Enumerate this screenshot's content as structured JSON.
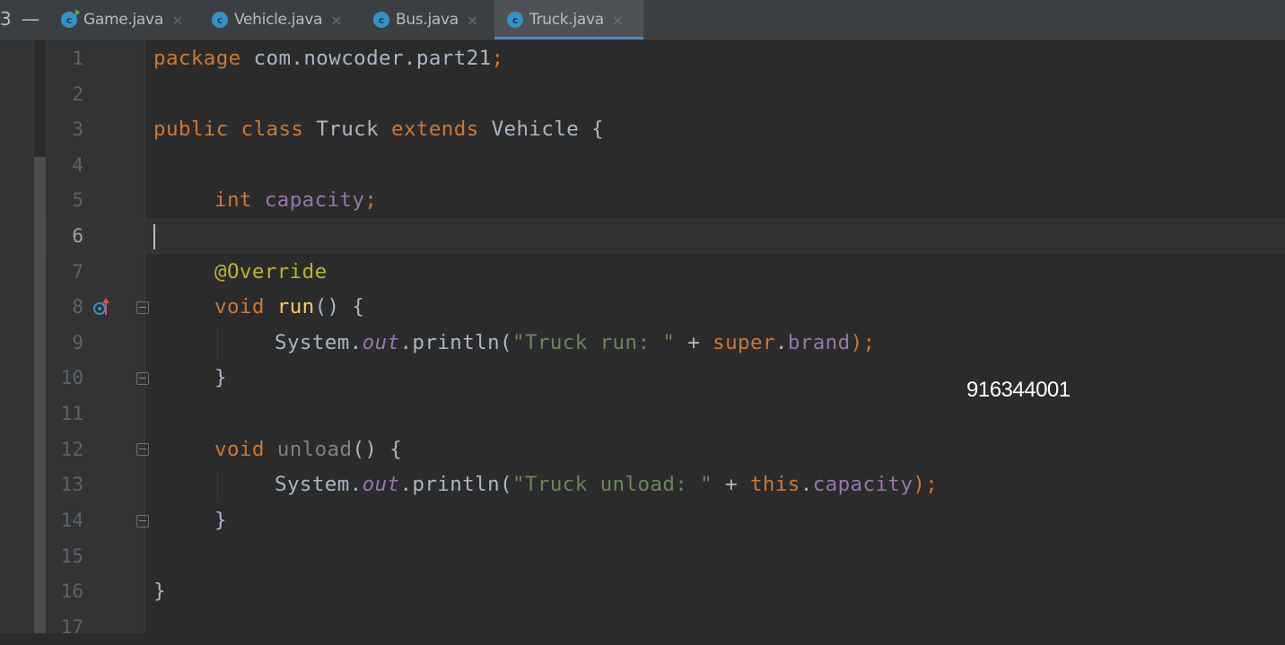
{
  "tabs": [
    {
      "label": "Game.java",
      "icon": "class-run-icon",
      "active": false
    },
    {
      "label": "Vehicle.java",
      "icon": "class-icon",
      "active": false
    },
    {
      "label": "Bus.java",
      "icon": "class-icon",
      "active": false
    },
    {
      "label": "Truck.java",
      "icon": "class-icon",
      "active": true
    }
  ],
  "tab_close_glyph": "×",
  "class_icon_letter": "c",
  "left_controls": {
    "hide": "—",
    "edge": "3"
  },
  "current_line": 6,
  "line_numbers": [
    "1",
    "2",
    "3",
    "4",
    "5",
    "6",
    "7",
    "8",
    "9",
    "10",
    "11",
    "12",
    "13",
    "14",
    "15",
    "16",
    "17"
  ],
  "code": {
    "l1": {
      "kw": "package",
      "rest": " com.nowcoder.part21",
      "semi": ";"
    },
    "l3": {
      "kw1": "public",
      "kw2": "class",
      "name": "Truck",
      "kw3": "extends",
      "sup": "Vehicle",
      "brace": "{"
    },
    "l5": {
      "kw": "int",
      "field": "capacity",
      "semi": ";"
    },
    "l7": {
      "ann": "@Override"
    },
    "l8": {
      "kw": "void",
      "fn": "run",
      "rest": "() {"
    },
    "l9": {
      "sys": "System.",
      "out": "out",
      "call": ".println(",
      "str": "\"Truck run: \"",
      "plus": " + ",
      "kw": "super",
      "dot": ".",
      "field": "brand",
      "end": ");"
    },
    "l10": {
      "brace": "}"
    },
    "l12": {
      "kw": "void",
      "fn": "unload",
      "rest": "() {"
    },
    "l13": {
      "sys": "System.",
      "out": "out",
      "call": ".println(",
      "str": "\"Truck unload: \"",
      "plus": " + ",
      "kw": "this",
      "dot": ".",
      "field": "capacity",
      "end": ");"
    },
    "l14": {
      "brace": "}"
    },
    "l16": {
      "brace": "}"
    }
  },
  "overlay_text": "916344001",
  "colors": {
    "background": "#2b2b2b",
    "keyword": "#cc7832",
    "field": "#9876aa",
    "string": "#6a8759",
    "annotation": "#bbb529",
    "tab_underline": "#4a88c7"
  }
}
